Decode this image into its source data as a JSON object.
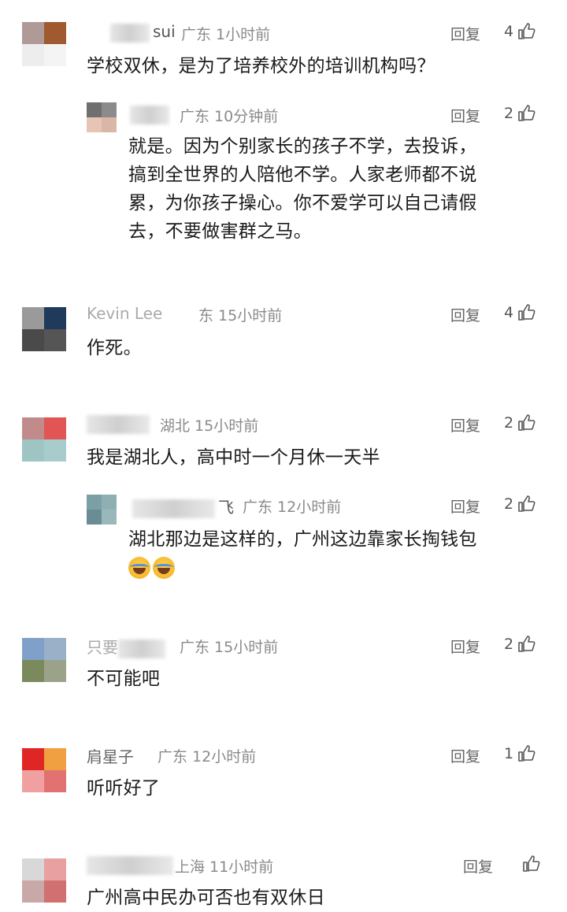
{
  "comments": [
    {
      "name": "sui",
      "location_time": "广东 1小时前",
      "reply_label": "回复",
      "likes": "4",
      "text": "学校双休，是为了培养校外的培训机构吗？",
      "avatar_colors": [
        "#b09a98",
        "#a05a30",
        "#ededed",
        "#f4f4f4"
      ]
    },
    {
      "name": "",
      "location_time": "广东 10分钟前",
      "reply_label": "回复",
      "likes": "2",
      "text_lines": [
        "就是。因为个别家长的孩子不学，去投诉，",
        "搞到全世界的人陪他不学。人家老师都不说",
        "累，为你孩子操心。你不爱学可以自己请假",
        "去，不要做害群之马。"
      ],
      "avatar_colors": [
        "#6f6f6f",
        "#8b8b8b",
        "#e8c4b5",
        "#d9b6a6"
      ]
    },
    {
      "name": "Kevin Lee",
      "location_time": "东 15小时前",
      "reply_label": "回复",
      "likes": "4",
      "text": "作死。",
      "avatar_colors": [
        "#9a9a9a",
        "#1f3a5a",
        "#4a4a4a",
        "#555555"
      ]
    },
    {
      "name": "",
      "location_time": "湖北 15小时前",
      "reply_label": "回复",
      "likes": "2",
      "text": "我是湖北人，高中时一个月休一天半",
      "avatar_colors": [
        "#c28b8b",
        "#e25555",
        "#9fc4c4",
        "#a8cccc"
      ]
    },
    {
      "name": "飞",
      "location_time": "广东 12小时前",
      "reply_label": "回复",
      "likes": "2",
      "text": "湖北那边是这样的，广州这边靠家长掏钱包",
      "emoji": "😂😂",
      "avatar_colors": [
        "#7aa0a6",
        "#8fb0b3",
        "#6a8c94",
        "#9ab8bb"
      ]
    },
    {
      "name": "只要",
      "location_time": "广东 15小时前",
      "reply_label": "回复",
      "likes": "2",
      "text": "不可能吧",
      "avatar_colors": [
        "#7fa0c8",
        "#9ab0c8",
        "#7a8a5c",
        "#9aa38a"
      ]
    },
    {
      "name": "肩星子",
      "location_time": "广东 12小时前",
      "reply_label": "回复",
      "likes": "1",
      "text": "听听好了",
      "avatar_colors": [
        "#e02525",
        "#f0a040",
        "#f0a0a0",
        "#e27272"
      ]
    },
    {
      "name": "",
      "location_time": "上海 11小时前",
      "reply_label": "回复",
      "likes": "",
      "text": "广州高中民办可否也有双休日",
      "avatar_colors": [
        "#d8d8d8",
        "#e8a0a0",
        "#c9a8a8",
        "#d07070"
      ]
    }
  ]
}
